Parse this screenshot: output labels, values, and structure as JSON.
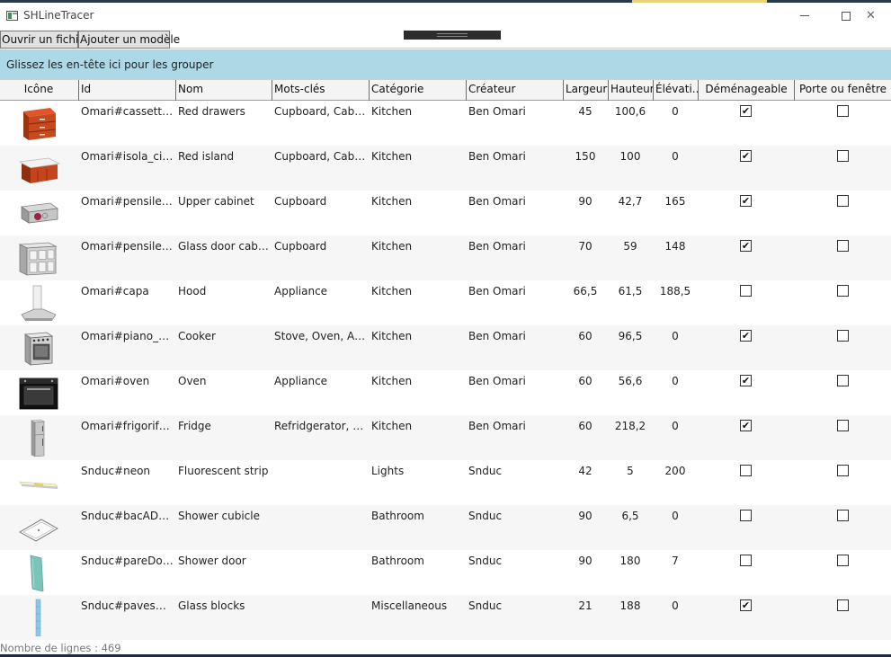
{
  "window": {
    "title": "SHLineTracer"
  },
  "toolbar": {
    "open_label": "Ouvrir un fichier",
    "add_label": "Ajouter un modèle"
  },
  "group_panel": {
    "text": "Glissez les en-tête ici pour les grouper"
  },
  "columns": [
    "Icône",
    "Id",
    "Nom",
    "Mots-clés",
    "Catégorie",
    "Créateur",
    "Largeur",
    "Hauteur",
    "Élévati...",
    "Déménageable",
    "Porte ou fenêtre"
  ],
  "rows": [
    {
      "icon": "red-drawers-icon",
      "id": "Omari#cassetti_c...",
      "name": "Red drawers",
      "keywords": "Cupboard, Cabinet",
      "category": "Kitchen",
      "creator": "Ben Omari",
      "width": "45",
      "height": "100,6",
      "elevation": "0",
      "movable": true,
      "door_or_window": false
    },
    {
      "icon": "red-island-icon",
      "id": "Omari#isola_cicin...",
      "name": "Red island",
      "keywords": "Cupboard, Cabinet",
      "category": "Kitchen",
      "creator": "Ben Omari",
      "width": "150",
      "height": "100",
      "elevation": "0",
      "movable": true,
      "door_or_window": false
    },
    {
      "icon": "upper-cabinet-icon",
      "id": "Omari#pensile_cu...",
      "name": "Upper cabinet",
      "keywords": "Cupboard",
      "category": "Kitchen",
      "creator": "Ben Omari",
      "width": "90",
      "height": "42,7",
      "elevation": "165",
      "movable": true,
      "door_or_window": false
    },
    {
      "icon": "glass-door-cabinet-icon",
      "id": "Omari#pensile_cu...",
      "name": "Glass door cabinet",
      "keywords": "Cupboard",
      "category": "Kitchen",
      "creator": "Ben Omari",
      "width": "70",
      "height": "59",
      "elevation": "148",
      "movable": true,
      "door_or_window": false
    },
    {
      "icon": "hood-icon",
      "id": "Omari#capa",
      "name": "Hood",
      "keywords": "Appliance",
      "category": "Kitchen",
      "creator": "Ben Omari",
      "width": "66,5",
      "height": "61,5",
      "elevation": "188,5",
      "movable": false,
      "door_or_window": false
    },
    {
      "icon": "cooker-icon",
      "id": "Omari#piano_cot...",
      "name": "Cooker",
      "keywords": "Stove, Oven, Appl...",
      "category": "Kitchen",
      "creator": "Ben Omari",
      "width": "60",
      "height": "96,5",
      "elevation": "0",
      "movable": true,
      "door_or_window": false
    },
    {
      "icon": "oven-icon",
      "id": "Omari#oven",
      "name": "Oven",
      "keywords": "Appliance",
      "category": "Kitchen",
      "creator": "Ben Omari",
      "width": "60",
      "height": "56,6",
      "elevation": "0",
      "movable": true,
      "door_or_window": false
    },
    {
      "icon": "fridge-icon",
      "id": "Omari#frigorifero",
      "name": "Fridge",
      "keywords": "Refridgerator, Fre...",
      "category": "Kitchen",
      "creator": "Ben Omari",
      "width": "60",
      "height": "218,2",
      "elevation": "0",
      "movable": true,
      "door_or_window": false
    },
    {
      "icon": "fluorescent-strip-icon",
      "id": "Snduc#neon",
      "name": "Fluorescent strip",
      "keywords": "",
      "category": "Lights",
      "creator": "Snduc",
      "width": "42",
      "height": "5",
      "elevation": "200",
      "movable": false,
      "door_or_window": false
    },
    {
      "icon": "shower-cubicle-icon",
      "id": "Snduc#bacADouc...",
      "name": "Shower cubicle",
      "keywords": "",
      "category": "Bathroom",
      "creator": "Snduc",
      "width": "90",
      "height": "6,5",
      "elevation": "0",
      "movable": false,
      "door_or_window": false
    },
    {
      "icon": "shower-door-icon",
      "id": "Snduc#pareDouc...",
      "name": "Shower door",
      "keywords": "",
      "category": "Bathroom",
      "creator": "Snduc",
      "width": "90",
      "height": "180",
      "elevation": "7",
      "movable": false,
      "door_or_window": false
    },
    {
      "icon": "glass-blocks-icon",
      "id": "Snduc#pavesDeV...",
      "name": "Glass blocks",
      "keywords": "",
      "category": "Miscellaneous",
      "creator": "Snduc",
      "width": "21",
      "height": "188",
      "elevation": "0",
      "movable": true,
      "door_or_window": false
    }
  ],
  "status": {
    "row_count": "Nombre de lignes : 469"
  }
}
